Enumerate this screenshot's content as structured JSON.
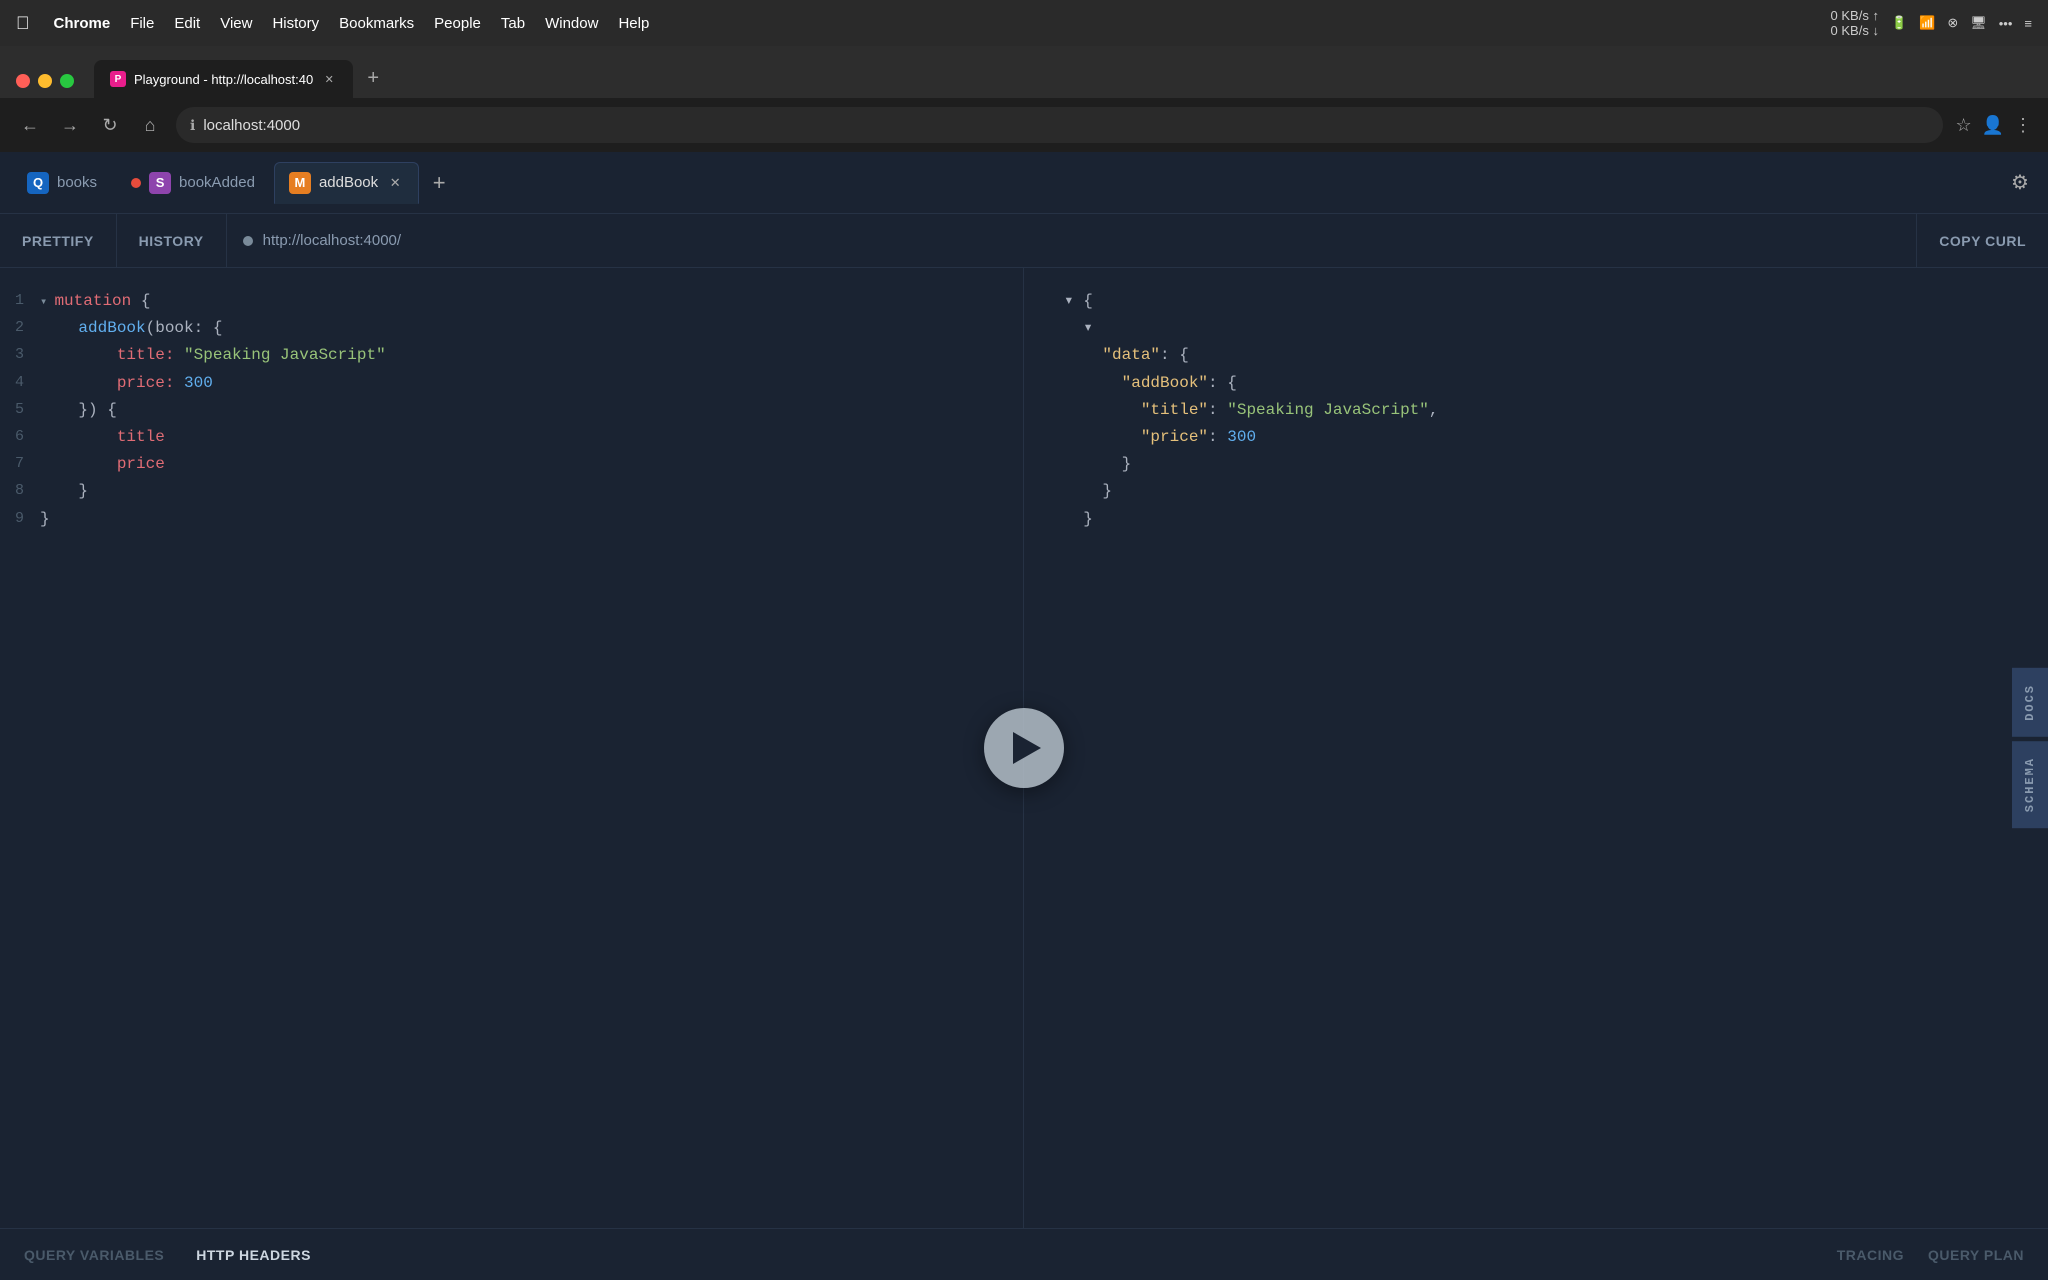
{
  "menubar": {
    "apple": "⌘",
    "items": [
      "Chrome",
      "File",
      "Edit",
      "View",
      "History",
      "Bookmarks",
      "People",
      "Tab",
      "Window",
      "Help"
    ],
    "right": {
      "network": "0 KB/s\n0 KB/s",
      "battery": "🔋",
      "wifi": "WiFi",
      "time": "..."
    }
  },
  "tabs": {
    "browser_tabs": [
      {
        "id": "tab-books",
        "label": "Playground - http://localhost:40",
        "favicon_letter": "P",
        "favicon_bg": "#e91e8c",
        "active": false
      }
    ],
    "active_tab_url": "localhost:4000"
  },
  "playground": {
    "tabs": [
      {
        "id": "books",
        "label": "books",
        "icon": "Q",
        "icon_bg": "#1565c0",
        "dot": null,
        "closable": false,
        "active": false
      },
      {
        "id": "bookAdded",
        "label": "bookAdded",
        "icon": "S",
        "icon_bg": "#8e44ad",
        "dot": true,
        "closable": false,
        "active": false
      },
      {
        "id": "addBook",
        "label": "addBook",
        "icon": "M",
        "icon_bg": "#e67e22",
        "dot": null,
        "closable": true,
        "active": true
      }
    ],
    "toolbar": {
      "prettify": "PRETTIFY",
      "history": "HISTORY",
      "url": "http://localhost:4000/",
      "copy_curl": "COPY CURL"
    },
    "editor": {
      "lines": [
        {
          "num": 1,
          "tokens": [
            {
              "text": "▾ ",
              "class": "kw-collapse"
            },
            {
              "text": "mutation",
              "class": "kw-mutation"
            },
            {
              "text": " {",
              "class": "kw-brace"
            }
          ]
        },
        {
          "num": 2,
          "tokens": [
            {
              "text": "  addBook",
              "class": "kw-func"
            },
            {
              "text": "(book: {",
              "class": "kw-brace"
            }
          ]
        },
        {
          "num": 3,
          "tokens": [
            {
              "text": "    title: ",
              "class": "kw-field"
            },
            {
              "text": "\"Speaking JavaScript\"",
              "class": "kw-string"
            }
          ]
        },
        {
          "num": 4,
          "tokens": [
            {
              "text": "    price: ",
              "class": "kw-field"
            },
            {
              "text": "300",
              "class": "kw-number"
            }
          ]
        },
        {
          "num": 5,
          "tokens": [
            {
              "text": "  }) {",
              "class": "kw-brace"
            }
          ]
        },
        {
          "num": 6,
          "tokens": [
            {
              "text": "    title",
              "class": "kw-field"
            }
          ]
        },
        {
          "num": 7,
          "tokens": [
            {
              "text": "    price",
              "class": "kw-field"
            }
          ]
        },
        {
          "num": 8,
          "tokens": [
            {
              "text": "  }",
              "class": "kw-brace"
            }
          ]
        },
        {
          "num": 9,
          "tokens": [
            {
              "text": "}",
              "class": "kw-brace"
            }
          ]
        }
      ]
    },
    "result": {
      "lines": [
        {
          "indent": 0,
          "tokens": [
            {
              "text": "▾ {",
              "class": "json-brace"
            }
          ]
        },
        {
          "indent": 1,
          "tokens": [
            {
              "text": "▾ ",
              "class": "json-brace"
            }
          ]
        },
        {
          "indent": 2,
          "tokens": [
            {
              "text": "\"data\"",
              "class": "json-key"
            },
            {
              "text": ": {",
              "class": "json-brace"
            }
          ]
        },
        {
          "indent": 3,
          "tokens": [
            {
              "text": "\"addBook\"",
              "class": "json-key"
            },
            {
              "text": ": {",
              "class": "json-brace"
            }
          ]
        },
        {
          "indent": 4,
          "tokens": [
            {
              "text": "\"title\"",
              "class": "json-key"
            },
            {
              "text": ": ",
              "class": "json-brace"
            },
            {
              "text": "\"Speaking JavaScript\"",
              "class": "json-string"
            },
            {
              "text": ",",
              "class": "json-brace"
            }
          ]
        },
        {
          "indent": 4,
          "tokens": [
            {
              "text": "\"price\"",
              "class": "json-key"
            },
            {
              "text": ": ",
              "class": "json-brace"
            },
            {
              "text": "300",
              "class": "json-number"
            }
          ]
        },
        {
          "indent": 3,
          "tokens": [
            {
              "text": "}",
              "class": "json-brace"
            }
          ]
        },
        {
          "indent": 2,
          "tokens": [
            {
              "text": "}",
              "class": "json-brace"
            }
          ]
        },
        {
          "indent": 1,
          "tokens": [
            {
              "text": "}",
              "class": "json-brace"
            }
          ]
        }
      ]
    },
    "side_buttons": [
      "DOCS",
      "SCHEMA"
    ],
    "bottom_bar": {
      "buttons": [
        "QUERY VARIABLES",
        "HTTP HEADERS"
      ],
      "right_buttons": [
        "TRACING",
        "QUERY PLAN"
      ]
    }
  }
}
